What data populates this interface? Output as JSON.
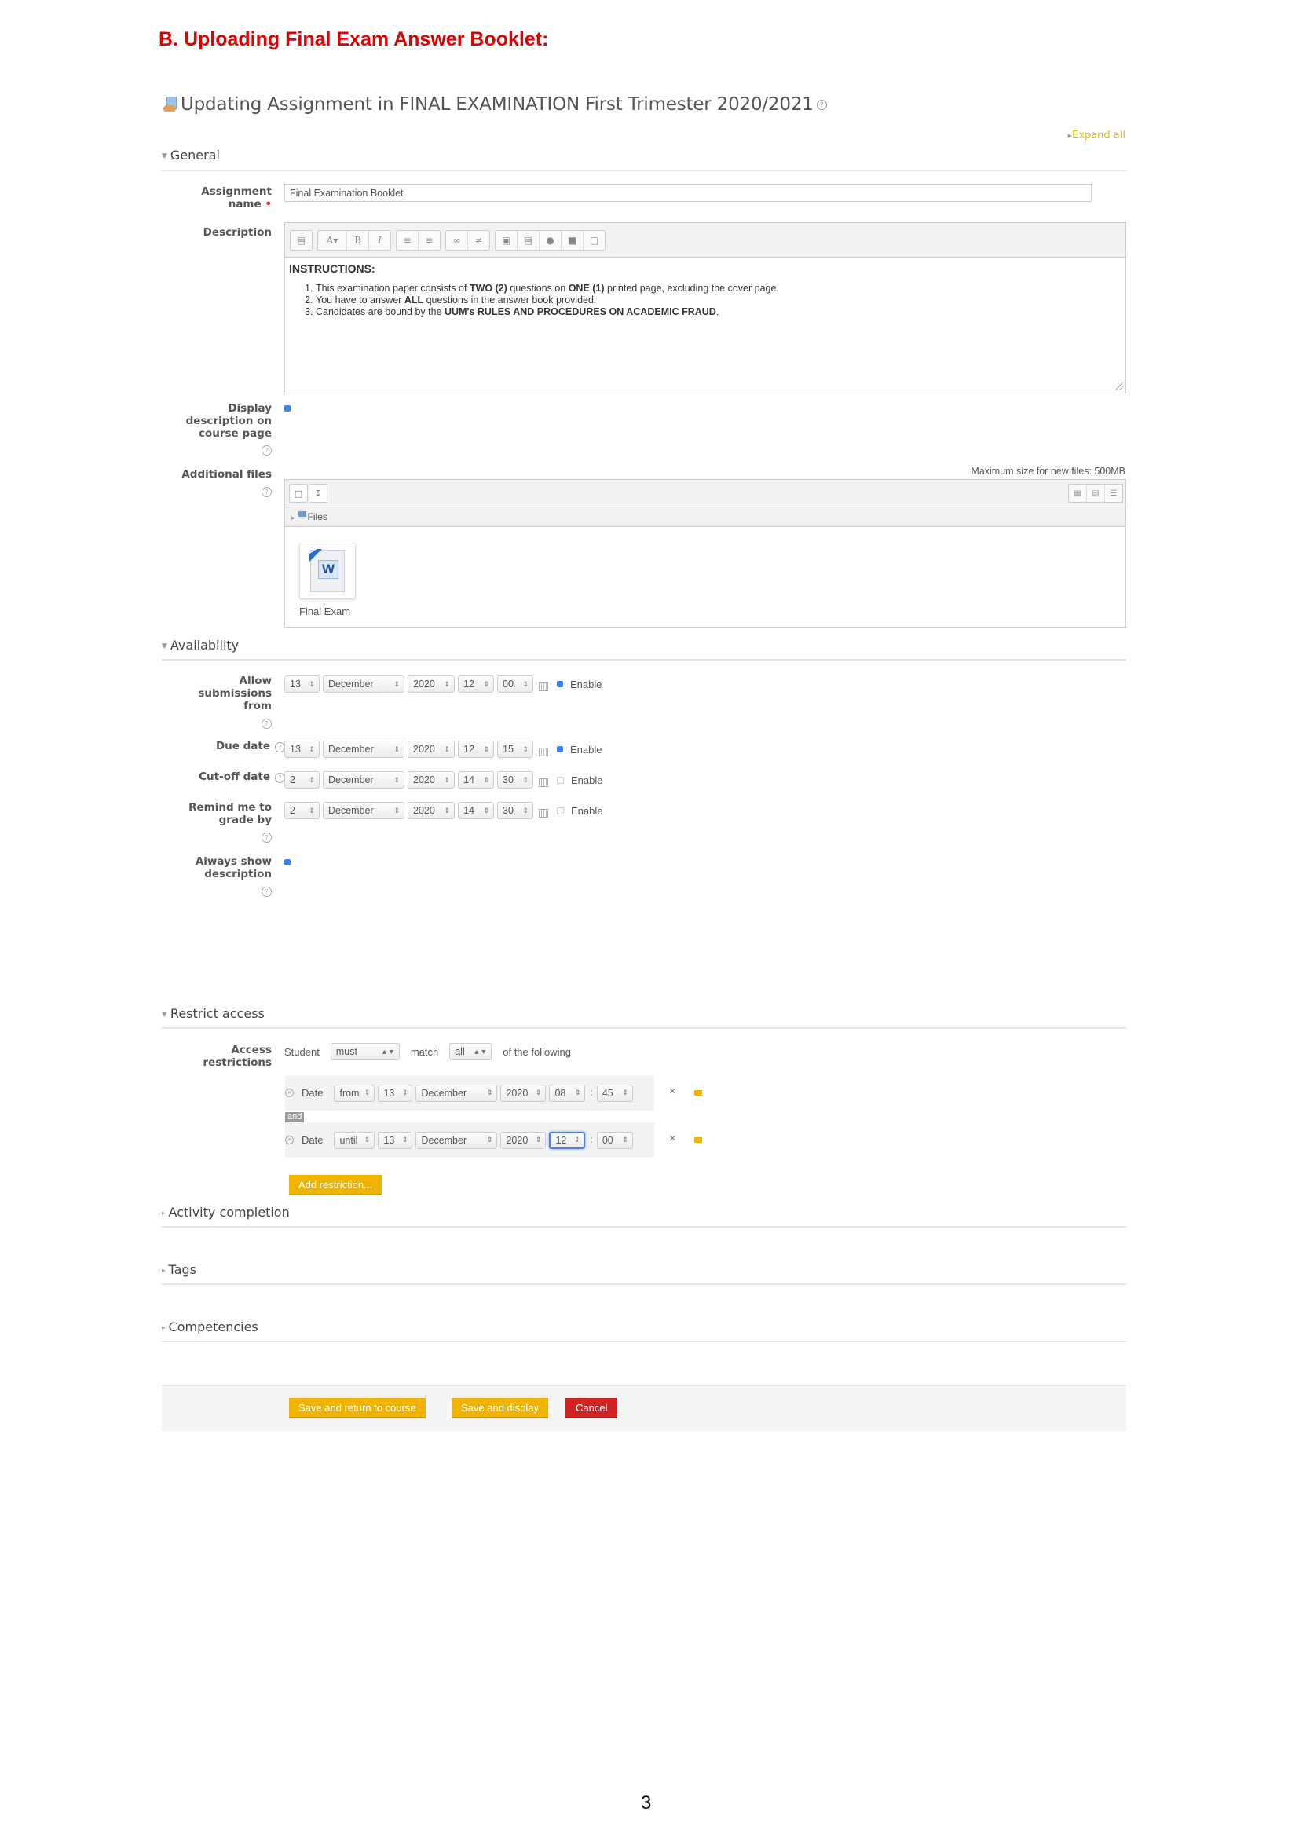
{
  "document": {
    "title": "B. Uploading Final Exam Answer Booklet:",
    "page_number": "3"
  },
  "page": {
    "heading": "Updating Assignment in FINAL EXAMINATION First Trimester 2020/2021",
    "heading_icon": "assignment-icon",
    "expand_all": "Expand all"
  },
  "general": {
    "header": "General",
    "assignment_name_label_line1": "Assignment",
    "assignment_name_label_line2": "name",
    "assignment_name_value": "Final Examination Booklet",
    "description_label": "Description",
    "toolbar": {
      "groups": [
        [
          "show-more-icon"
        ],
        [
          "font-style-icon",
          "bold-icon",
          "italic-icon"
        ],
        [
          "unordered-list-icon",
          "ordered-list-icon"
        ],
        [
          "link-icon",
          "unlink-icon"
        ],
        [
          "image-icon",
          "media-icon",
          "record-audio-icon",
          "record-video-icon",
          "manage-files-icon"
        ]
      ]
    },
    "description": {
      "heading": "INSTRUCTIONS:",
      "items": [
        {
          "parts": [
            {
              "t": "This examination paper consists of "
            },
            {
              "t": "TWO (2)",
              "b": true
            },
            {
              "t": " questions on "
            },
            {
              "t": "ONE (1)",
              "b": true
            },
            {
              "t": " printed page, excluding the cover page."
            }
          ]
        },
        {
          "parts": [
            {
              "t": "You have to answer "
            },
            {
              "t": "ALL",
              "b": true
            },
            {
              "t": " questions in the answer book provided."
            }
          ]
        },
        {
          "parts": [
            {
              "t": "Candidates are bound by the "
            },
            {
              "t": "UUM's RULES AND PROCEDURES ON ACADEMIC FRAUD",
              "b": true
            },
            {
              "t": "."
            }
          ]
        }
      ]
    },
    "display_description_label_line1": "Display",
    "display_description_label_line2": "description on",
    "display_description_label_line3": "course page",
    "display_description_checked": true,
    "additional_files_label": "Additional files",
    "max_size": "Maximum size for new files: 500MB",
    "files_path": "Files",
    "files": [
      {
        "name": "Final Exam",
        "type": "word-document"
      }
    ]
  },
  "availability": {
    "header": "Availability",
    "enable_label": "Enable",
    "rows": [
      {
        "label_lines": [
          "Allow",
          "submissions",
          "from"
        ],
        "day": "13",
        "month": "December",
        "year": "2020",
        "hour": "12",
        "minute": "00",
        "enabled": true,
        "help": true
      },
      {
        "label_lines": [
          "Due date"
        ],
        "day": "13",
        "month": "December",
        "year": "2020",
        "hour": "12",
        "minute": "15",
        "enabled": true,
        "help": true
      },
      {
        "label_lines": [
          "Cut-off date"
        ],
        "day": "2",
        "month": "December",
        "year": "2020",
        "hour": "14",
        "minute": "30",
        "enabled": false,
        "help": true
      },
      {
        "label_lines": [
          "Remind me to",
          "grade by"
        ],
        "day": "2",
        "month": "December",
        "year": "2020",
        "hour": "14",
        "minute": "30",
        "enabled": false,
        "help": true
      }
    ],
    "always_show_label_line1": "Always show",
    "always_show_label_line2": "description",
    "always_show_checked": true
  },
  "restrict_access": {
    "header": "Restrict access",
    "label_line1": "Access",
    "label_line2": "restrictions",
    "student": "Student",
    "must_value": "must",
    "match": "match",
    "all_value": "all",
    "of_following": "of the following",
    "conjunction": "and",
    "conditions": [
      {
        "type": "Date",
        "direction": "from",
        "day": "13",
        "month": "December",
        "year": "2020",
        "hour": "08",
        "minute": "45",
        "focused_field": ""
      },
      {
        "type": "Date",
        "direction": "until",
        "day": "13",
        "month": "December",
        "year": "2020",
        "hour": "12",
        "minute": "00",
        "focused_field": "hour"
      }
    ],
    "add_restriction": "Add restriction..."
  },
  "collapsed_sections": [
    {
      "header": "Activity completion"
    },
    {
      "header": "Tags"
    },
    {
      "header": "Competencies"
    }
  ],
  "buttons": {
    "save_return": "Save and return to course",
    "save_display": "Save and display",
    "cancel": "Cancel"
  },
  "colors": {
    "accent": "#f0b400",
    "danger": "#d32222",
    "title_red": "#e00000",
    "checkbox_blue": "#3b82f6"
  }
}
